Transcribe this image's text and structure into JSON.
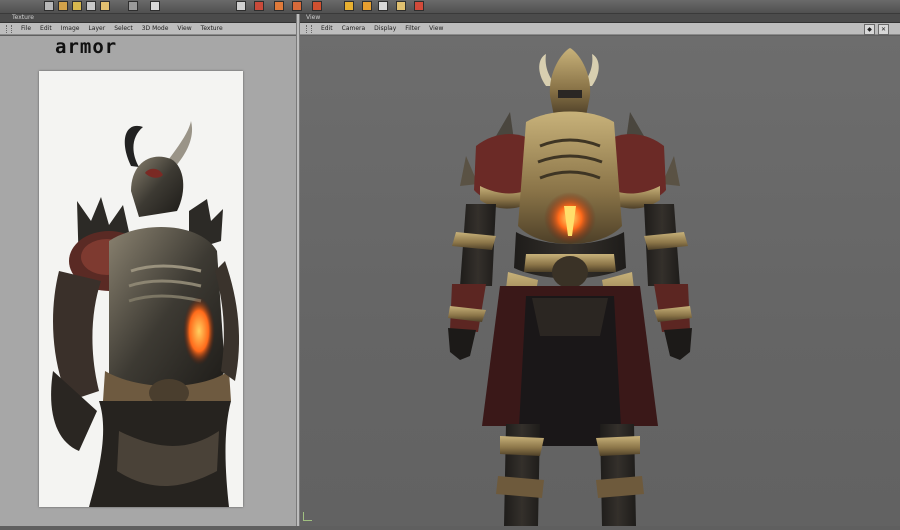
{
  "app": {
    "left_panel_title": "Texture",
    "right_panel_title": "View"
  },
  "texture_menu": [
    "File",
    "Edit",
    "Image",
    "Layer",
    "Select",
    "3D Mode",
    "View",
    "Texture"
  ],
  "viewport_menu": [
    "Edit",
    "Camera",
    "Display",
    "Filter",
    "View"
  ],
  "viewport_controls": [
    "◆",
    "✕"
  ],
  "reference_sheet": {
    "title": "armor"
  },
  "shelf_icons": [
    {
      "name": "brush-tool-icon",
      "color": "#d2a24a"
    },
    {
      "name": "paint-tool-icon",
      "color": "#d8b84e"
    },
    {
      "name": "lasso-tool-icon",
      "color": "#c8c8c8"
    },
    {
      "name": "layer-tool-icon",
      "color": "#e2c070"
    },
    {
      "name": "stamp-tool-icon",
      "color": "#c94a3a"
    },
    {
      "name": "eraser-tool-icon",
      "color": "#d8d8d8"
    },
    {
      "name": "clone-tool-icon",
      "color": "#e07a3a"
    },
    {
      "name": "fill-tool-icon",
      "color": "#d86a3a"
    },
    {
      "name": "grid-tool-icon",
      "color": "#e8b030"
    },
    {
      "name": "mask-tool-icon",
      "color": "#d9d9d9"
    },
    {
      "name": "warp-tool-icon",
      "color": "#d05030"
    }
  ],
  "colors": {
    "viewport_bg": "#666666",
    "panel_bg": "#a7a7a7",
    "glow": "#ff6a1a"
  }
}
